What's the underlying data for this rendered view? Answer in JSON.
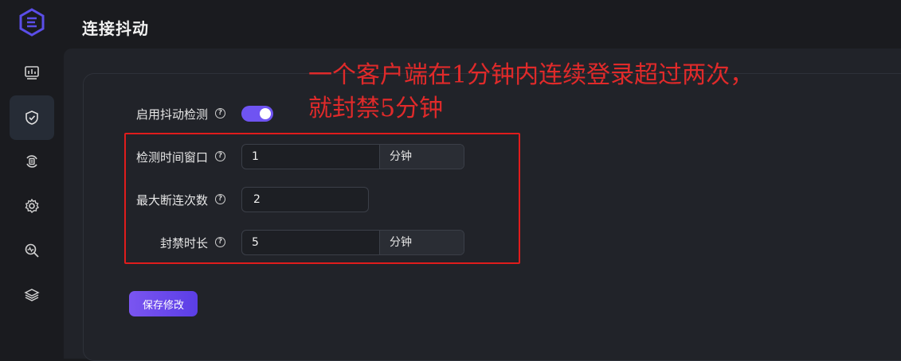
{
  "page": {
    "title": "连接抖动"
  },
  "sidebar": {
    "items": [
      {
        "icon": "dashboard-icon"
      },
      {
        "icon": "shield-check-icon",
        "active": true
      },
      {
        "icon": "sync-icon"
      },
      {
        "icon": "settings-icon"
      },
      {
        "icon": "search-monitor-icon"
      },
      {
        "icon": "layers-icon"
      }
    ]
  },
  "form": {
    "enable": {
      "label": "启用抖动检测",
      "value": true
    },
    "window": {
      "label": "检测时间窗口",
      "value": "1",
      "unit": "分钟"
    },
    "max_disconnects": {
      "label": "最大断连次数",
      "value": "2"
    },
    "ban_duration": {
      "label": "封禁时长",
      "value": "5",
      "unit": "分钟"
    },
    "help_glyph": "?",
    "save_label": "保存修改"
  },
  "annotation": {
    "line1": "一个客户端在1分钟内连续登录超过两次，",
    "line2": "就封禁5分钟",
    "color": "#e02a2a"
  },
  "colors": {
    "accent": "#6f54f2",
    "background": "#1a1b1f",
    "panel": "#212329"
  }
}
